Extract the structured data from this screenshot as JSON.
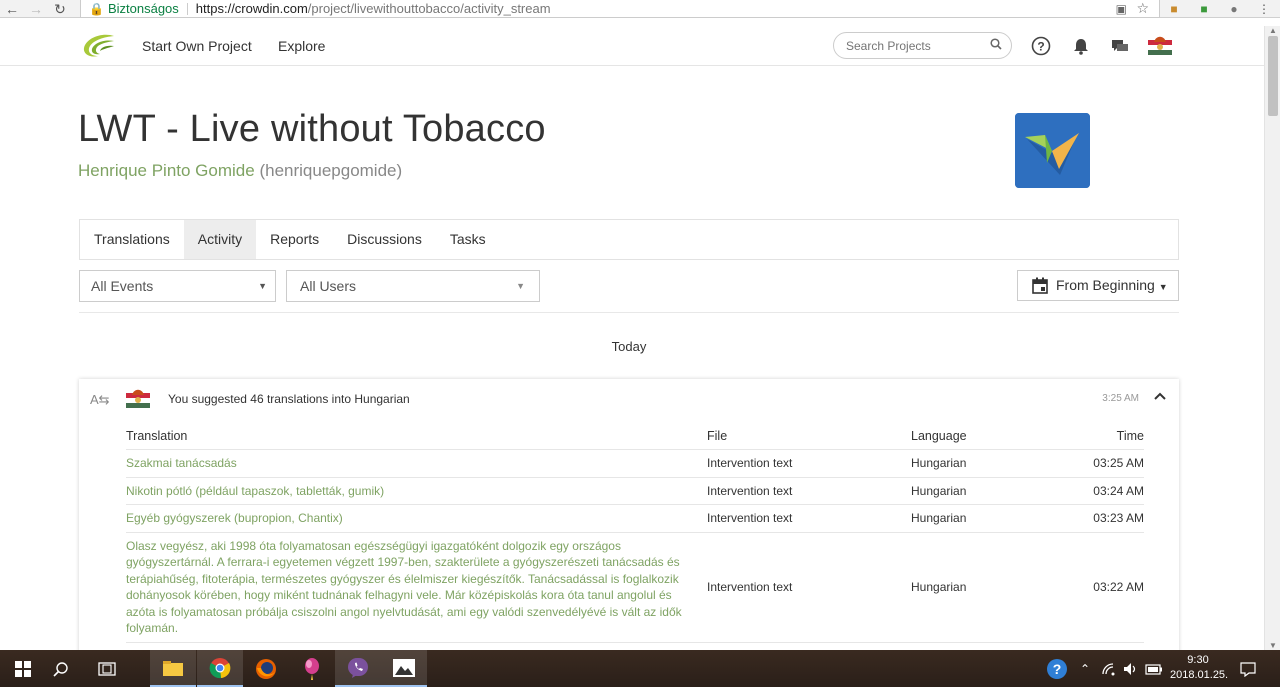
{
  "browser": {
    "secure_label": "Biztonságos",
    "url_host": "https://crowdin.com",
    "url_path": "/project/livewithouttobacco/activity_stream"
  },
  "topnav": {
    "links": [
      "Start Own Project",
      "Explore"
    ],
    "search_placeholder": "Search Projects"
  },
  "project": {
    "title": "LWT - Live without Tobacco",
    "owner_name": "Henrique Pinto Gomide",
    "owner_username": "(henriquepgomide)"
  },
  "tabs": [
    {
      "label": "Translations",
      "active": false
    },
    {
      "label": "Activity",
      "active": true
    },
    {
      "label": "Reports",
      "active": false
    },
    {
      "label": "Discussions",
      "active": false
    },
    {
      "label": "Tasks",
      "active": false
    }
  ],
  "filters": {
    "events": "All Events",
    "users": "All Users",
    "date": "From Beginning"
  },
  "stream": {
    "day": "Today",
    "event": {
      "text": "You suggested 46 translations into Hungarian",
      "time": "3:25 AM"
    },
    "columns": {
      "translation": "Translation",
      "file": "File",
      "language": "Language",
      "time": "Time"
    },
    "rows": [
      {
        "translation": "Szakmai tanácsadás",
        "file": "Intervention text",
        "language": "Hungarian",
        "time": "03:25 AM"
      },
      {
        "translation": "Nikotin pótló (például tapaszok, tabletták, gumik)",
        "file": "Intervention text",
        "language": "Hungarian",
        "time": "03:24 AM"
      },
      {
        "translation": "Egyéb gyógyszerek (bupropion, Chantix)",
        "file": "Intervention text",
        "language": "Hungarian",
        "time": "03:23 AM"
      },
      {
        "translation": "Olasz vegyész, aki 1998 óta folyamatosan egészségügyi igazgatóként dolgozik egy országos gyógyszertárnál. A ferrara-i egyetemen végzett 1997-ben, szakterülete a gyógyszerészeti tanácsadás és terápiahűség, fitoterápia, természetes gyógyszer és élelmiszer kiegészítők. Tanácsadással is foglalkozik dohányosok körében, hogy miként tudnának felhagyni vele. Már középiskolás kora óta tanul angolul és azóta is folyamatosan próbálja csiszolni angol nyelvtudását, ami egy valódi szenvedélyévé is vált az idők folyamán.",
        "file": "Intervention text",
        "language": "Hungarian",
        "time": "03:22 AM"
      }
    ]
  },
  "taskbar": {
    "clock_time": "9:30",
    "clock_date": "2018.01.25."
  },
  "colors": {
    "accent_green": "#7fa363",
    "active_tab_bg": "#ededed",
    "project_logo_blue": "#2e6fbf"
  }
}
